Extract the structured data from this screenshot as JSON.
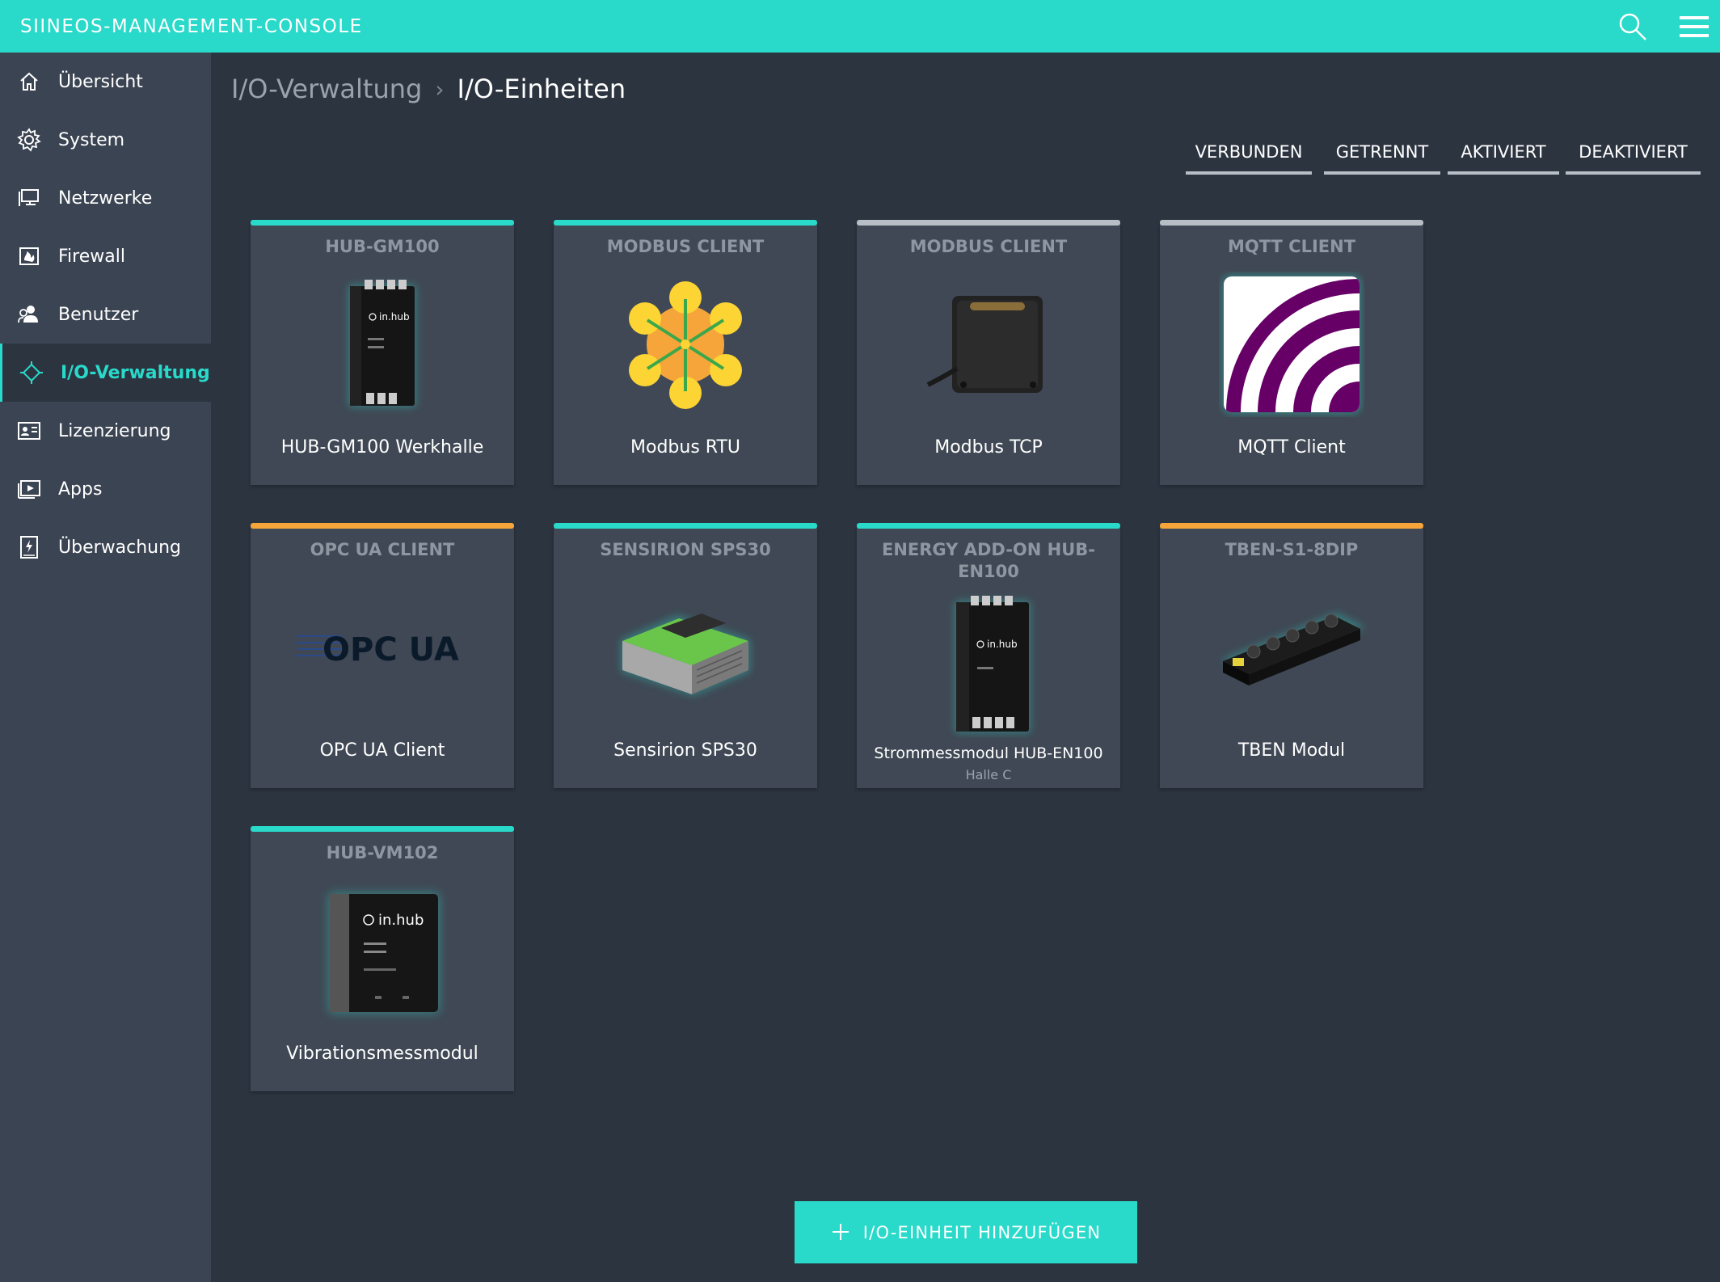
{
  "app": {
    "title": "SIINEOS-MANAGEMENT-CONSOLE",
    "brand_color": "#29d9c9"
  },
  "header": {
    "search_icon": "search-icon",
    "menu_icon": "hamburger-menu-icon"
  },
  "sidebar": {
    "items": [
      {
        "label": "Übersicht",
        "icon": "home-icon",
        "active": false
      },
      {
        "label": "System",
        "icon": "gear-icon",
        "active": false
      },
      {
        "label": "Netzwerke",
        "icon": "network-monitor-icon",
        "active": false
      },
      {
        "label": "Firewall",
        "icon": "firewall-icon",
        "active": false
      },
      {
        "label": "Benutzer",
        "icon": "users-icon",
        "active": false
      },
      {
        "label": "I/O-Verwaltung",
        "icon": "io-icon",
        "active": true
      },
      {
        "label": "Lizenzierung",
        "icon": "license-card-icon",
        "active": false
      },
      {
        "label": "Apps",
        "icon": "apps-icon",
        "active": false
      },
      {
        "label": "Überwachung",
        "icon": "monitoring-icon",
        "active": false
      }
    ],
    "collapse_icon": "double-chevron-left-icon"
  },
  "breadcrumb": {
    "parent": "I/O-Verwaltung",
    "separator": "›",
    "current": "I/O-Einheiten"
  },
  "filters": [
    "VERBUNDEN",
    "GETRENNT",
    "AKTIVIERT",
    "DEAKTIVIERT"
  ],
  "status_colors": {
    "connected": "#29d9c9",
    "disconnected": "#b8bec5",
    "warning": "#f5a53a"
  },
  "cards": [
    {
      "type": "HUB-GM100",
      "name": "HUB-GM100 Werkhalle",
      "status_color": "#29d9c9",
      "image": "hub-gm100-device-image"
    },
    {
      "type": "MODBUS CLIENT",
      "name": "Modbus RTU",
      "status_color": "#29d9c9",
      "image": "modbus-rtu-image"
    },
    {
      "type": "MODBUS CLIENT",
      "name": "Modbus TCP",
      "status_color": "#b8bec5",
      "image": "modbus-tcp-sensor-image"
    },
    {
      "type": "MQTT CLIENT",
      "name": "MQTT Client",
      "status_color": "#b8bec5",
      "image": "mqtt-logo-image"
    },
    {
      "type": "OPC UA CLIENT",
      "name": "OPC UA Client",
      "status_color": "#f5a53a",
      "image": "opc-ua-logo-image"
    },
    {
      "type": "SENSIRION SPS30",
      "name": "Sensirion SPS30",
      "status_color": "#29d9c9",
      "image": "sensirion-sps30-image"
    },
    {
      "type": "ENERGY ADD-ON HUB-EN100",
      "name": "Strommessmodul HUB-EN100",
      "sub": "Halle C",
      "status_color": "#29d9c9",
      "image": "hub-en100-device-image"
    },
    {
      "type": "TBEN-S1-8DIP",
      "name": "TBEN Modul",
      "status_color": "#f5a53a",
      "image": "tben-module-image"
    },
    {
      "type": "HUB-VM102",
      "name": "Vibrationsmessmodul",
      "status_color": "#29d9c9",
      "image": "hub-vm102-device-image"
    }
  ],
  "opc_logo_text": "OPC UA",
  "inhub_text": "in.hub",
  "add_button": {
    "label": "I/O-EINHEIT HINZUFÜGEN",
    "icon": "plus-icon"
  }
}
